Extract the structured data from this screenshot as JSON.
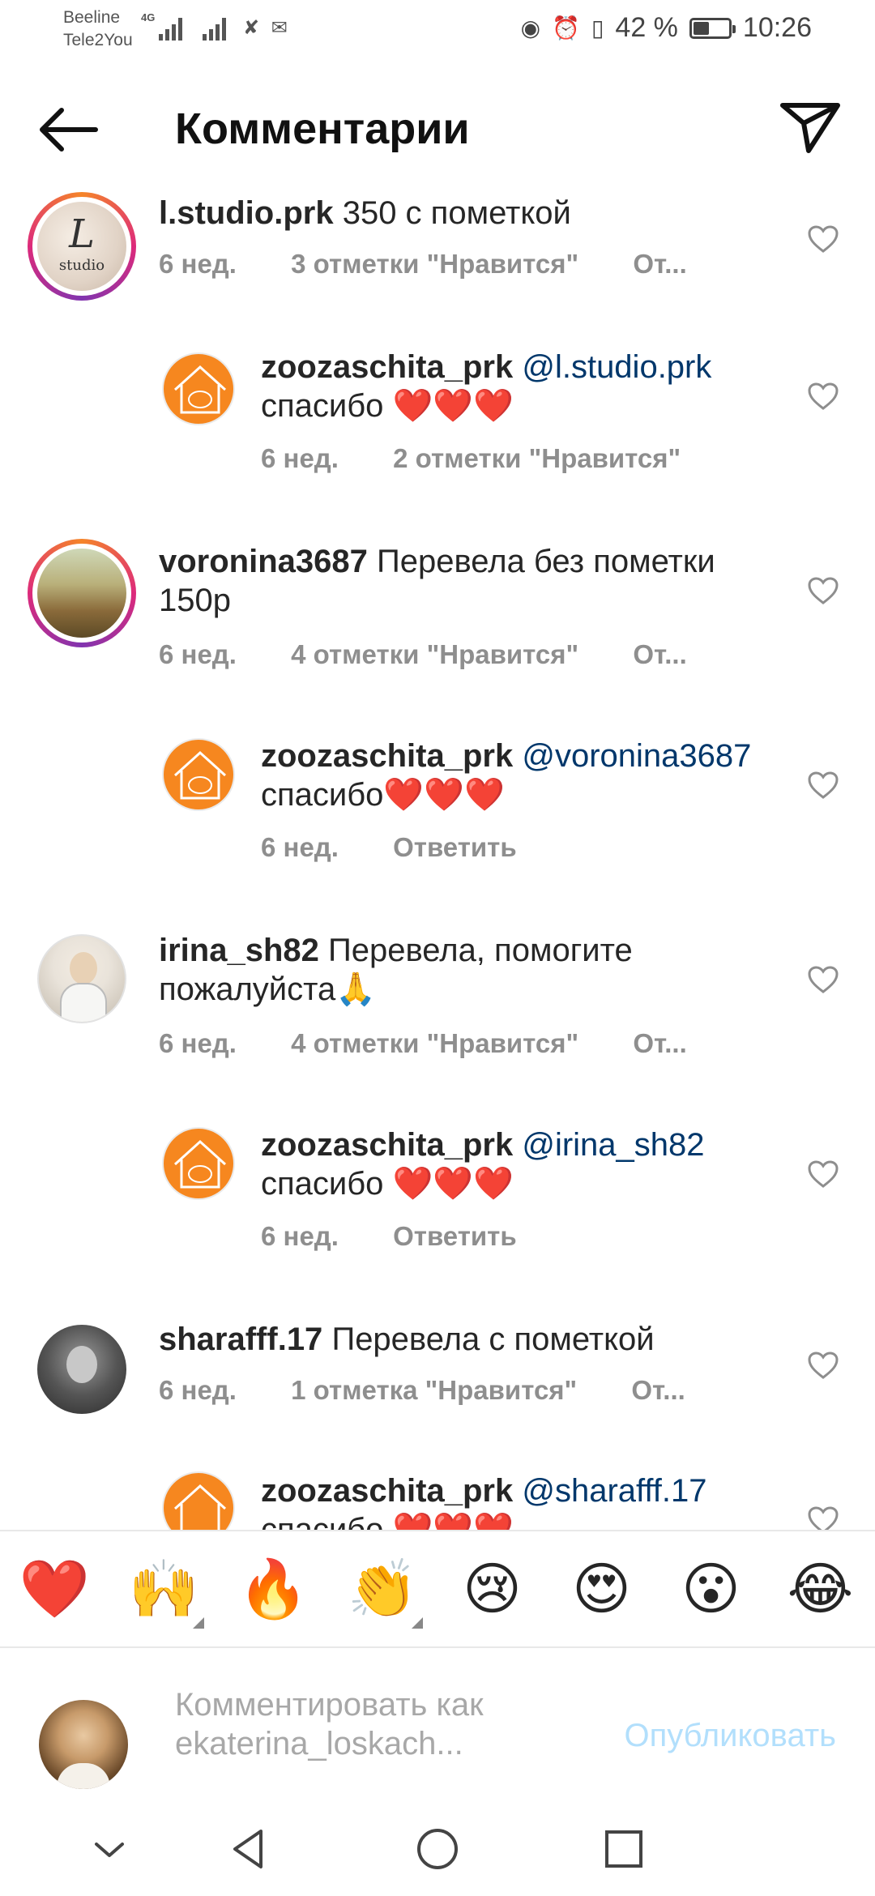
{
  "status_bar": {
    "carrier_1": "Beeline",
    "carrier_2": "Tele2You",
    "network": "4G",
    "battery": "42 %",
    "battery_level": 0.42,
    "time": "10:26"
  },
  "header": {
    "title": "Комментарии"
  },
  "comments": [
    {
      "username": "l.studio.prk",
      "text": "350 с пометкой",
      "text_line2": "",
      "time": "6 нед.",
      "likes": "3 отметки \"Нравится\"",
      "reply": "От..."
    },
    {
      "username": "zoozaschita_prk",
      "mention": "@l.studio.prk",
      "text": "спасибо ❤️❤️❤️",
      "time": "6 нед.",
      "likes": "2 отметки \"Нравится\"",
      "reply": ""
    },
    {
      "username": "voronina3687",
      "text": "Перевела без пометки",
      "text_line2": "150р",
      "time": "6 нед.",
      "likes": "4 отметки \"Нравится\"",
      "reply": "От..."
    },
    {
      "username": "zoozaschita_prk",
      "mention": "@voronina3687",
      "text": "спасибо❤️❤️❤️",
      "time": "6 нед.",
      "likes": "",
      "reply": "Ответить"
    },
    {
      "username": "irina_sh82",
      "text": "Перевела, помогите",
      "text_line2": "пожалуйста🙏",
      "time": "6 нед.",
      "likes": "4 отметки \"Нравится\"",
      "reply": "От..."
    },
    {
      "username": "zoozaschita_prk",
      "mention": "@irina_sh82",
      "text": "спасибо ❤️❤️❤️",
      "time": "6 нед.",
      "likes": "",
      "reply": "Ответить"
    },
    {
      "username": "sharafff.17",
      "text": "Перевела с пометкой",
      "text_line2": "",
      "time": "6 нед.",
      "likes": "1 отметка \"Нравится\"",
      "reply": "От..."
    },
    {
      "username": "zoozaschita_prk",
      "mention": "@sharafff.17",
      "text": "спасибо ❤️❤️❤️",
      "time": "",
      "likes": "",
      "reply": ""
    }
  ],
  "emoji_bar": [
    "❤️",
    "🙌",
    "🔥",
    "👏",
    "😢",
    "😍",
    "😮",
    "😂"
  ],
  "compose": {
    "placeholder_line1": "Комментировать как",
    "placeholder_line2": "ekaterina_loskach...",
    "publish": "Опубликовать"
  },
  "colors": {
    "text": "#262626",
    "secondary": "#8e8e8e",
    "mention": "#00376b",
    "publish_disabled": "#b2dffc",
    "heart_red": "#e0222b"
  }
}
